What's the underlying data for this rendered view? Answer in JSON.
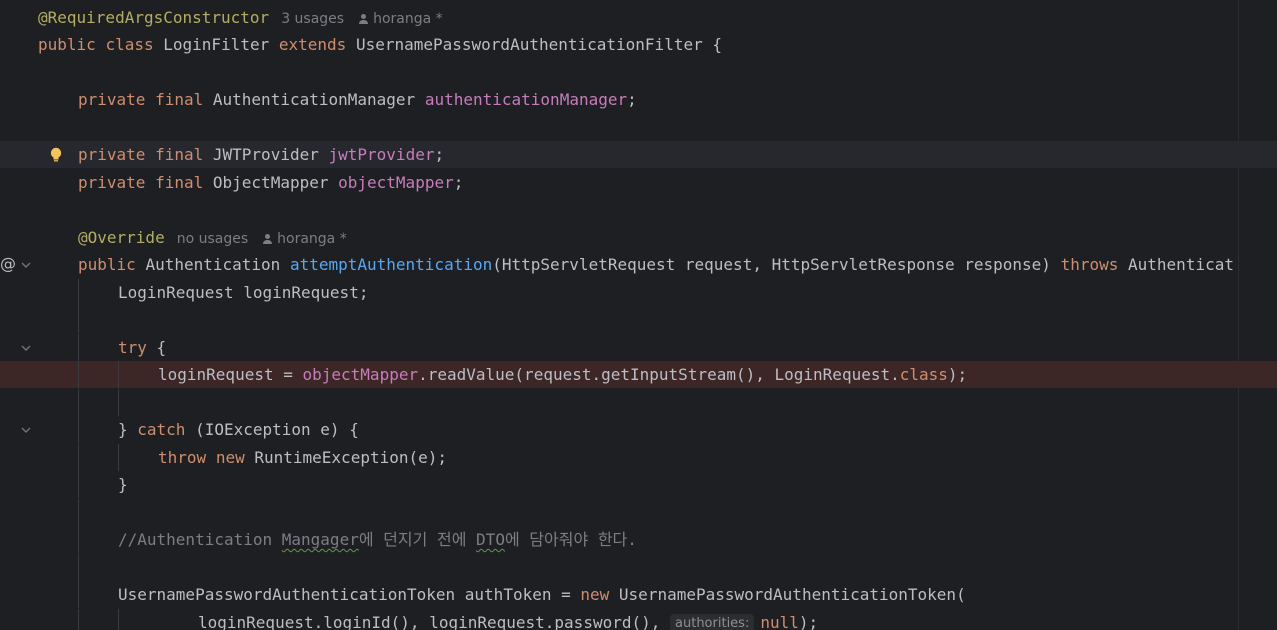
{
  "editor": {
    "class_annotation": "@RequiredArgsConstructor",
    "class_usages": "3 usages",
    "class_author": "horanga *",
    "class_decl": {
      "kw_public": "public",
      "kw_class": "class",
      "name": "LoginFilter",
      "kw_extends": "extends",
      "super": "UsernamePasswordAuthenticationFilter",
      "brace": "{"
    },
    "field_auth_manager": {
      "kw_private": "private",
      "kw_final": "final",
      "type": "AuthenticationManager",
      "name": "authenticationManager",
      "end": ";"
    },
    "field_jwt_provider": {
      "kw_private": "private",
      "kw_final": "final",
      "type": "JWTProvider",
      "name": "jwtProvider",
      "end": ";"
    },
    "field_object_mapper": {
      "kw_private": "private",
      "kw_final": "final",
      "type": "ObjectMapper",
      "name": "objectMapper",
      "end": ";"
    },
    "override_annotation": "@Override",
    "method_usages": "no usages",
    "method_author": "horanga *",
    "method_decl": {
      "kw_public": "public",
      "return_type": "Authentication",
      "name": "attemptAuthentication",
      "params": "(HttpServletRequest request, HttpServletResponse response)",
      "kw_throws": "throws",
      "exception": "Authenticat"
    },
    "local_decl": "LoginRequest loginRequest;",
    "try_kw": "try",
    "try_brace": " {",
    "read_value": {
      "lhs": "loginRequest = ",
      "field": "objectMapper",
      "call": ".readValue(request.getInputStream(), LoginRequest.",
      "kw_class": "class",
      "end": ");"
    },
    "catch_line": {
      "close": "} ",
      "kw_catch": "catch",
      "rest": " (IOException e) {"
    },
    "throw_line": {
      "kw_throw": "throw",
      "kw_new": "new",
      "rest": "RuntimeException(e);"
    },
    "close_brace": "}",
    "comment": {
      "prefix": "//Authentication ",
      "word1": "Mangager",
      "mid": "에 던지기 전에 ",
      "word2": "DTO",
      "suffix": "에 담아줘야 한다."
    },
    "token_decl": {
      "lhs": "UsernamePasswordAuthenticationToken authToken = ",
      "kw_new": "new",
      "rest": " UsernamePasswordAuthenticationToken("
    },
    "token_args": {
      "args": "loginRequest.loginId(), loginRequest.password(), ",
      "param_hint": "authorities:",
      "kw_null": "null",
      "end": ");"
    }
  }
}
